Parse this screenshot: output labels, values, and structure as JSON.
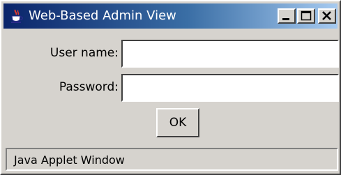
{
  "window": {
    "title": "Web-Based Admin View",
    "title_icon": "java-cup-icon",
    "controls": {
      "minimize_icon": "minimize-icon",
      "maximize_icon": "maximize-icon",
      "close_icon": "close-icon"
    },
    "colors": {
      "titlebar_start": "#0a246a",
      "titlebar_end": "#a6caf0",
      "face": "#d6d3ce"
    }
  },
  "form": {
    "username_label": "User name:",
    "username_value": "",
    "password_label": "Password:",
    "password_value": "",
    "ok_label": "OK"
  },
  "status": {
    "text": "Java Applet Window"
  }
}
